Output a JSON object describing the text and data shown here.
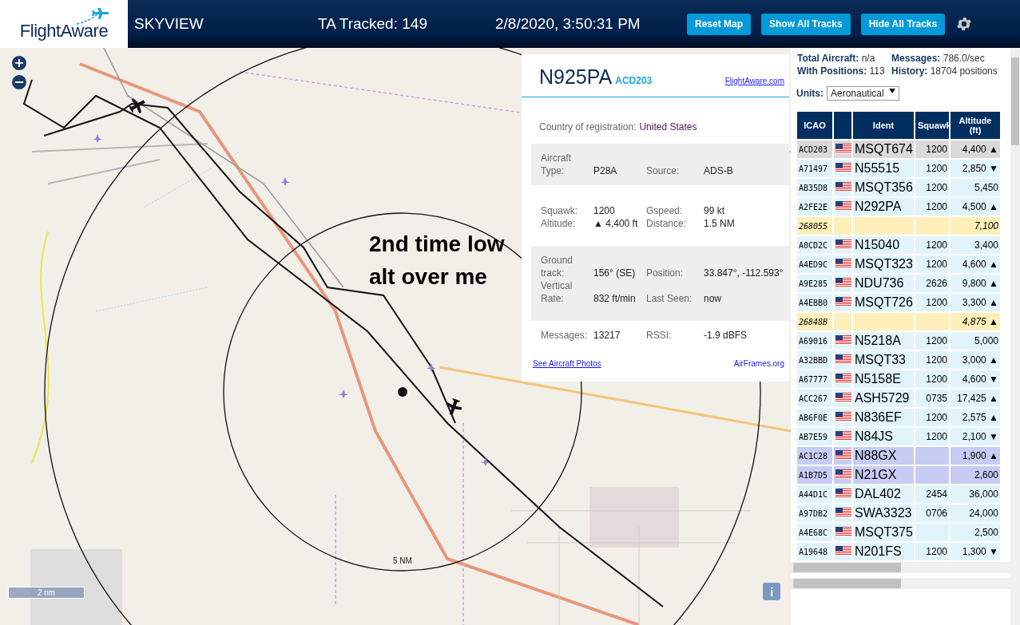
{
  "header": {
    "logo": "FlightAware",
    "title": "SKYVIEW",
    "tracked": "TA Tracked: 149",
    "datetime": "2/8/2020, 3:50:31 PM",
    "buttons": [
      "Reset Map",
      "Show All Tracks",
      "Hide All Tracks"
    ]
  },
  "map": {
    "zoom_in": "+",
    "zoom_out": "−",
    "ring_label": "5 NM",
    "annotation": "2nd time low alt over me",
    "scale": "2 nm",
    "info_button": "i"
  },
  "info": {
    "registration": "N925PA",
    "icao": "ACD203",
    "link": "FlightAware.com",
    "country_label": "Country of registration:",
    "country": "United States",
    "sections": [
      {
        "shaded": true,
        "fields": [
          {
            "label": "Aircraft Type:",
            "value": "P28A"
          },
          {
            "label": "Source:",
            "value": "ADS-B"
          }
        ]
      },
      {
        "shaded": false,
        "fields": [
          {
            "label": "Squawk:",
            "value": "1200"
          },
          {
            "label": "Gspeed:",
            "value": "99 kt"
          },
          {
            "label": "Altitude:",
            "value": "▲ 4,400 ft"
          },
          {
            "label": "Distance:",
            "value": "1.5 NM"
          }
        ]
      },
      {
        "shaded": true,
        "fields": [
          {
            "label": "Ground track:",
            "value": "156° (SE)"
          },
          {
            "label": "Position:",
            "value": "33.847°, -112.593°"
          },
          {
            "label": "Vertical Rate:",
            "value": "832 ft/min"
          },
          {
            "label": "Last Seen:",
            "value": "now"
          }
        ]
      },
      {
        "shaded": false,
        "fields": [
          {
            "label": "Messages:",
            "value": "13217"
          },
          {
            "label": "RSSI:",
            "value": "-1.9 dBFS"
          }
        ]
      }
    ],
    "photos_link": "See Aircraft Photos",
    "airframes_link": "AirFrames.org"
  },
  "stats": [
    {
      "label": "Total Aircraft:",
      "value": "n/a"
    },
    {
      "label": "Messages:",
      "value": "786.0/sec"
    },
    {
      "label": "With Positions:",
      "value": "113"
    },
    {
      "label": "History:",
      "value": "18704 positions"
    }
  ],
  "units": {
    "label": "Units:",
    "value": "Aeronautical"
  },
  "table": {
    "columns": [
      "ICAO",
      "Ident",
      "Squawk",
      "Altitude (ft)"
    ],
    "rows": [
      {
        "kind": "adsb",
        "selected": true,
        "icao": "ACD203",
        "ident": "MSQT674",
        "squawk": "1200",
        "altitude": "4,400",
        "trend": "▲"
      },
      {
        "kind": "adsb",
        "selected": false,
        "icao": "A71497",
        "ident": "N55515",
        "squawk": "1200",
        "altitude": "2,850",
        "trend": "▼"
      },
      {
        "kind": "adsb",
        "selected": false,
        "icao": "AB35D8",
        "ident": "MSQT356",
        "squawk": "1200",
        "altitude": "5,450"
      },
      {
        "kind": "adsb",
        "selected": false,
        "icao": "A2FE2E",
        "ident": "N292PA",
        "squawk": "1200",
        "altitude": "4,500",
        "trend": "▲"
      },
      {
        "kind": "tisb",
        "selected": false,
        "icao": "268055",
        "altitude": "7,100"
      },
      {
        "kind": "adsb",
        "selected": false,
        "icao": "A0CD2C",
        "ident": "N15040",
        "squawk": "1200",
        "altitude": "3,400"
      },
      {
        "kind": "adsb",
        "selected": false,
        "icao": "A4ED9C",
        "ident": "MSQT323",
        "squawk": "1200",
        "altitude": "4,600",
        "trend": "▲"
      },
      {
        "kind": "adsb",
        "selected": false,
        "icao": "A9E285",
        "ident": "NDU736",
        "squawk": "2626",
        "altitude": "9,800",
        "trend": "▲"
      },
      {
        "kind": "adsb",
        "selected": false,
        "icao": "A4EBB0",
        "ident": "MSQT726",
        "squawk": "1200",
        "altitude": "3,300",
        "trend": "▲"
      },
      {
        "kind": "tisb",
        "selected": false,
        "icao": "26848B",
        "altitude": "4,875",
        "trend": "▲"
      },
      {
        "kind": "adsb",
        "selected": false,
        "icao": "A69016",
        "ident": "N5218A",
        "squawk": "1200",
        "altitude": "5,000"
      },
      {
        "kind": "adsb",
        "selected": false,
        "icao": "A32BBD",
        "ident": "MSQT33",
        "squawk": "1200",
        "altitude": "3,000",
        "trend": "▲"
      },
      {
        "kind": "adsb",
        "selected": false,
        "icao": "A67777",
        "ident": "N5158E",
        "squawk": "1200",
        "altitude": "4,600",
        "trend": "▼"
      },
      {
        "kind": "adsb",
        "selected": false,
        "icao": "ACC267",
        "ident": "ASH5729",
        "squawk": "0735",
        "altitude": "17,425",
        "trend": "▲"
      },
      {
        "kind": "adsb",
        "selected": false,
        "icao": "AB6F0E",
        "ident": "N836EF",
        "squawk": "1200",
        "altitude": "2,575",
        "trend": "▲"
      },
      {
        "kind": "adsb",
        "selected": false,
        "icao": "AB7E59",
        "ident": "N84JS",
        "squawk": "1200",
        "altitude": "2,100",
        "trend": "▼"
      },
      {
        "kind": "mlat",
        "selected": false,
        "icao": "AC1C28",
        "ident": "N88GX",
        "altitude": "1,900",
        "trend": "▲"
      },
      {
        "kind": "mlat",
        "selected": false,
        "icao": "A1B7D5",
        "ident": "N21GX",
        "altitude": "2,600"
      },
      {
        "kind": "adsb",
        "selected": false,
        "icao": "A44D1C",
        "ident": "DAL402",
        "squawk": "2454",
        "altitude": "36,000"
      },
      {
        "kind": "adsb",
        "selected": false,
        "icao": "A97DB2",
        "ident": "SWA3323",
        "squawk": "0706",
        "altitude": "24,000"
      },
      {
        "kind": "adsb",
        "selected": false,
        "icao": "A4E68C",
        "ident": "MSQT375",
        "altitude": "2,500"
      },
      {
        "kind": "adsb",
        "selected": false,
        "icao": "A19648",
        "ident": "N201FS",
        "squawk": "1200",
        "altitude": "1,300",
        "trend": "▼"
      }
    ]
  }
}
